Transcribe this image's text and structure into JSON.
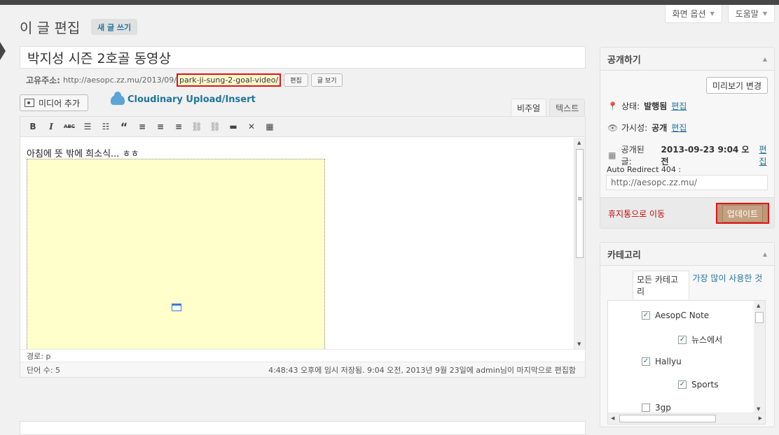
{
  "header": {
    "page_title": "이 글 편집",
    "add_new_label": "새 글 쓰기",
    "screen_options_label": "화면 옵션",
    "help_label": "도움말"
  },
  "post": {
    "title": "박지성 시즌 2호골 동영상",
    "permalink_label": "고유주소:",
    "permalink_base": "http://aesopc.zz.mu/2013/09/",
    "permalink_slug": "park-ji-sung-2-goal-video/",
    "edit_slug_label": "편집",
    "view_post_label": "글 보기"
  },
  "media": {
    "add_media_label": "미디어 추가",
    "cloudinary_label": "Cloudinary Upload/Insert"
  },
  "editor": {
    "tab_visual": "비주얼",
    "tab_text": "텍스트",
    "body_text": "아침에 뜻 밖에 희소식... ㅎㅎ",
    "path_label": "경로: p",
    "word_count": "단어 수: 5",
    "autosave_status": "4:48:43 오후에 임시 저장됨. 9:04 오전, 2013년 9월 23일에 admin님이 마지막으로 편집함",
    "toolbar": [
      "B",
      "I",
      "ABC",
      "ul",
      "ol",
      "quote",
      "align-left",
      "align-center",
      "align-right",
      "link",
      "unlink",
      "more",
      "fullscreen",
      "kitchen-sink"
    ]
  },
  "publish": {
    "title": "공개하기",
    "preview_changes_label": "미리보기 변경",
    "status_label": "상태:",
    "status_value": "발행됨",
    "visibility_label": "가시성:",
    "visibility_value": "공개",
    "published_label": "공개된 글:",
    "published_value": "2013-09-23 9:04 오전",
    "edit_label": "편집",
    "auto_redirect_label": "Auto Redirect 404 :",
    "auto_redirect_placeholder": "http://aesopc.zz.mu/",
    "trash_label": "휴지통으로 이동",
    "update_label": "업데이트"
  },
  "category": {
    "title": "카테고리",
    "tab_all": "모든 카테고리",
    "tab_popular": "가장 많이 사용한 것",
    "items": [
      {
        "label": "AesopC Note",
        "checked": true
      },
      {
        "label": "뉴스에서",
        "checked": true
      },
      {
        "label": "Hallyu",
        "checked": true
      },
      {
        "label": "Sports",
        "checked": true
      },
      {
        "label": "3gp",
        "checked": false
      }
    ]
  },
  "colors": {
    "accent": "#21759b",
    "highlight_border": "#e0121a",
    "update_button": "#bd9978",
    "trash_link": "#bc0b0b",
    "embed_background": "#ffffcc"
  }
}
